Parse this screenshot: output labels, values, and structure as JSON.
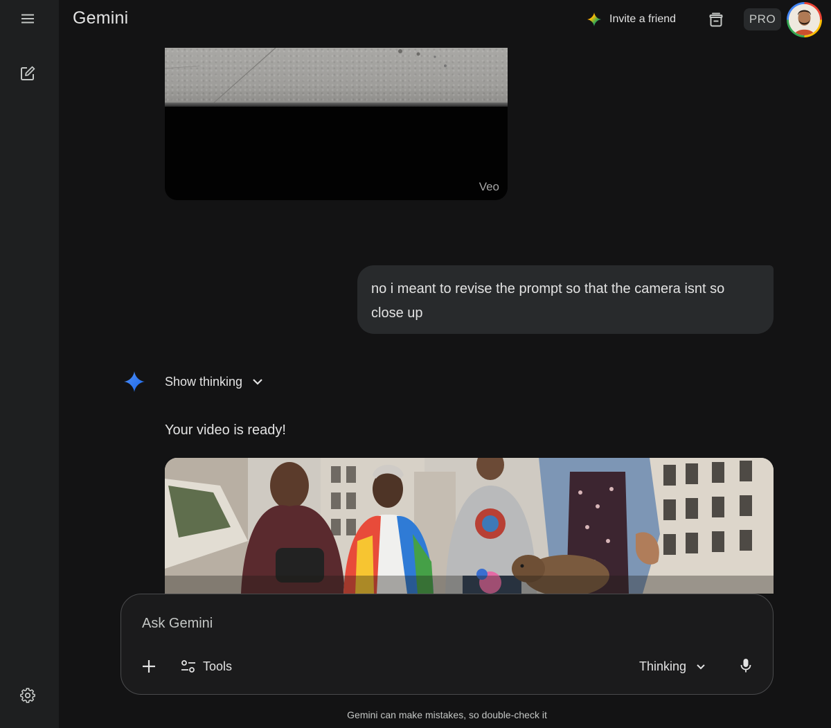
{
  "header": {
    "brand": "Gemini",
    "invite_label": "Invite a friend",
    "plan_badge": "PRO"
  },
  "sidebar": {
    "menu_icon": "menu-icon",
    "new_chat_icon": "edit-icon",
    "settings_icon": "gear-icon"
  },
  "conversation": {
    "previous_video": {
      "watermark": "Veo"
    },
    "user_message": "no i meant to revise the prompt so that the camera isnt so close up",
    "model_turn": {
      "show_thinking_label": "Show thinking",
      "reply_text": "Your video is ready!"
    }
  },
  "composer": {
    "placeholder": "Ask Gemini",
    "tools_label": "Tools",
    "mode_label": "Thinking",
    "add_icon": "plus-icon",
    "tools_icon": "tools-icon",
    "mic_icon": "mic-icon"
  },
  "footer": {
    "disclaimer": "Gemini can make mistakes, so double-check it"
  },
  "colors": {
    "background": "#131314",
    "rail": "#1e1f20",
    "bubble": "#282a2c",
    "accent_spark": "#4285f4"
  }
}
